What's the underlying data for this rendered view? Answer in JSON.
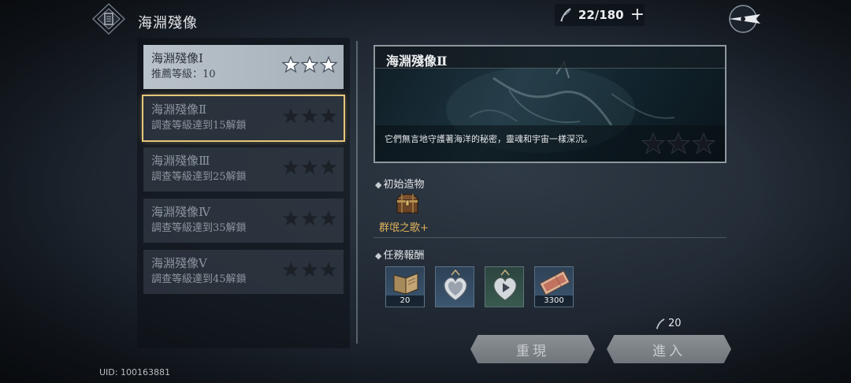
{
  "header": {
    "title": "海淵殘像",
    "stamina": "22/180",
    "add_symbol": "+"
  },
  "stages": [
    {
      "name": "海淵殘像Ⅰ",
      "sub": "推薦等級：10",
      "state": "completed",
      "stars_earned": 3,
      "stars_total": 3
    },
    {
      "name": "海淵殘像Ⅱ",
      "sub": "調查等級達到15解鎖",
      "state": "selected",
      "stars_earned": 0,
      "stars_total": 3
    },
    {
      "name": "海淵殘像Ⅲ",
      "sub": "調查等級達到25解鎖",
      "state": "locked",
      "stars_earned": 0,
      "stars_total": 3
    },
    {
      "name": "海淵殘像Ⅳ",
      "sub": "調查等級達到35解鎖",
      "state": "locked",
      "stars_earned": 0,
      "stars_total": 3
    },
    {
      "name": "海淵殘像Ⅴ",
      "sub": "調查等級達到45解鎖",
      "state": "locked",
      "stars_earned": 0,
      "stars_total": 3
    }
  ],
  "detail": {
    "title": "海淵殘像Ⅱ",
    "description": "它們無言地守護著海洋的秘密，靈魂和宇宙一樣深沉。",
    "stars_earned": 0,
    "stars_total": 3
  },
  "initial_artifact": {
    "label": "初始造物",
    "name": "群氓之歌+",
    "icon": "treasure-chest-icon"
  },
  "rewards": {
    "label": "任務報酬",
    "items": [
      {
        "icon": "book-icon",
        "count": "20",
        "rarity_color": "#3b5670"
      },
      {
        "icon": "heart-locket-icon",
        "count": "",
        "rarity_color": "#3b5670"
      },
      {
        "icon": "heart-locket-play-icon",
        "count": "",
        "rarity_color": "#3a5a4f"
      },
      {
        "icon": "ticket-icon",
        "count": "3300",
        "rarity_color": "#3b5670"
      }
    ]
  },
  "cost": "20",
  "buttons": {
    "replay": "重現",
    "enter": "進入"
  },
  "uid": "UID: 100163881",
  "colors": {
    "accent_gold": "#e5c67a",
    "artifact_name": "#e0b45a"
  }
}
